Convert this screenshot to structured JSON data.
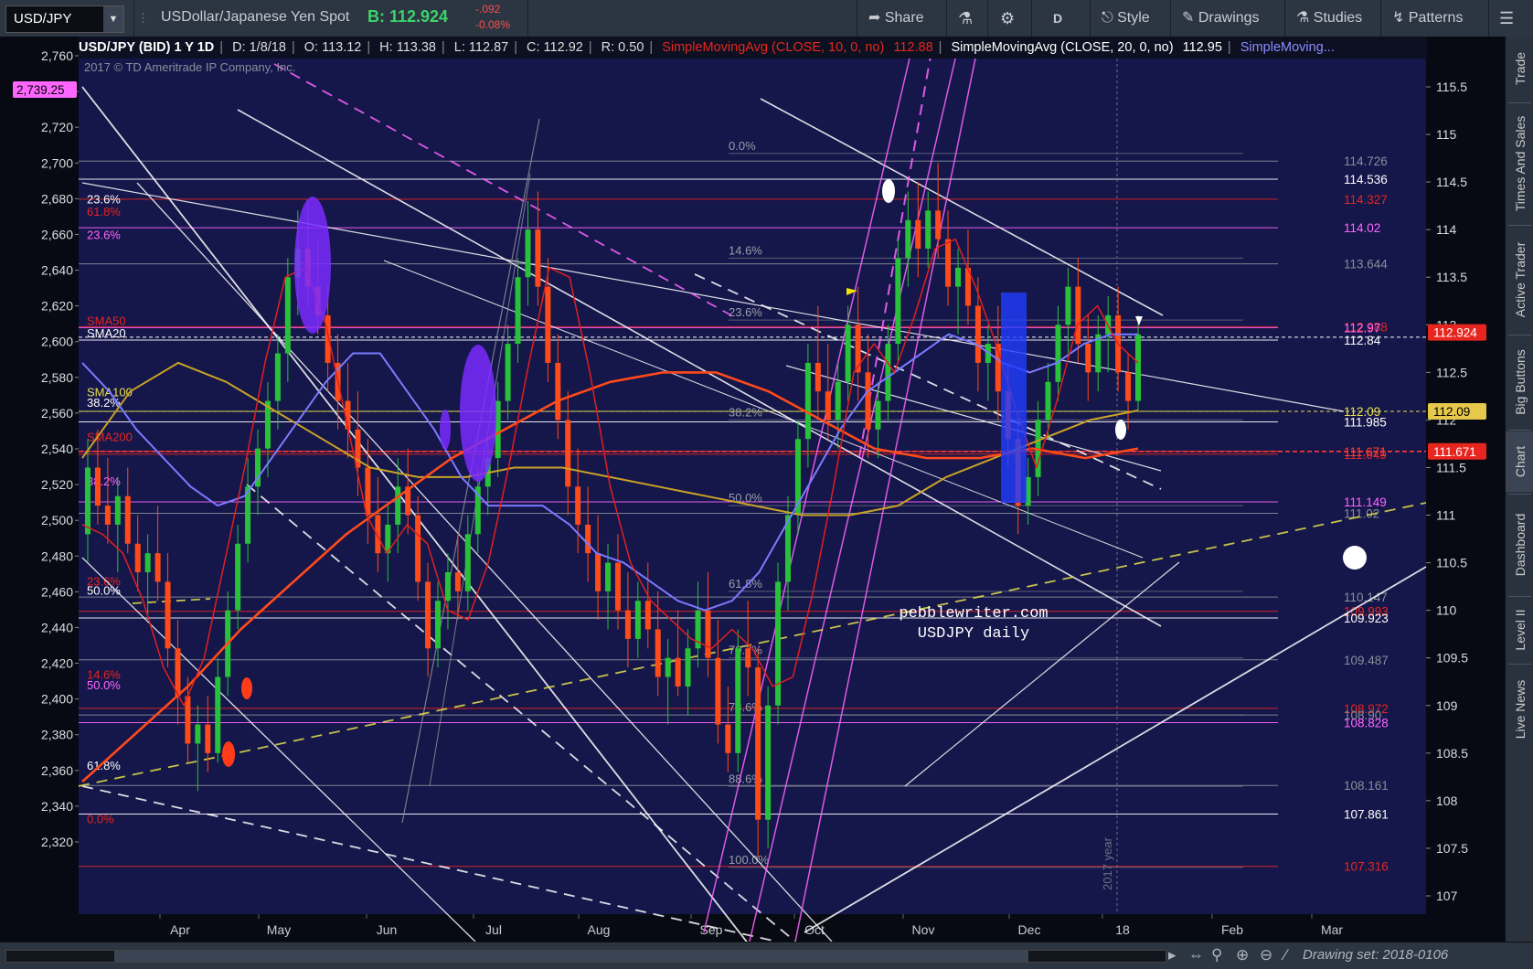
{
  "toolbar": {
    "symbol": "USD/JPY",
    "description": "USDollar/Japanese Yen Spot",
    "bid": "B: 112.924",
    "change": "-.092",
    "change_pct": "-0.08%",
    "share": "Share",
    "aggregation": "D",
    "style": "Style",
    "drawings": "Drawings",
    "studies": "Studies",
    "patterns": "Patterns"
  },
  "infobar": {
    "title": "USD/JPY (BID) 1 Y 1D",
    "date": "D: 1/8/18",
    "open": "O: 113.12",
    "high": "H: 113.38",
    "low": "L: 112.87",
    "close": "C: 112.92",
    "range": "R: 0.50",
    "sma10": "SimpleMovingAvg (CLOSE, 10, 0, no)",
    "sma10_val": "112.88",
    "sma20": "SimpleMovingAvg (CLOSE, 20, 0, no)",
    "sma20_val": "112.95",
    "sma_more": "SimpleMoving..."
  },
  "sidebar": [
    "Trade",
    "Times And Sales",
    "Active Trader",
    "Big Buttons",
    "Chart",
    "Dashboard",
    "Level II",
    "Live News"
  ],
  "bottom": {
    "drawing_set": "Drawing set: 2018-0106"
  },
  "chart_data": {
    "type": "candlestick",
    "copyright": "2017 © TD Ameritrade IP Company, Inc.",
    "watermark": [
      "pebblewriter.com",
      "USDJPY daily"
    ],
    "year_marker": "2017 year",
    "x_labels": [
      "Apr",
      "May",
      "Jun",
      "Jul",
      "Aug",
      "Sep",
      "Oct",
      "Nov",
      "Dec",
      "18",
      "Feb",
      "Mar"
    ],
    "y_right": {
      "min": 107,
      "max": 115.5,
      "ticks": [
        "115.5",
        "115",
        "114.5",
        "114",
        "113.5",
        "113",
        "112.5",
        "112",
        "111.5",
        "111",
        "110.5",
        "110",
        "109.5",
        "109",
        "108.5",
        "108",
        "107.5",
        "107"
      ]
    },
    "y_left": {
      "min": 2320,
      "max": 2760,
      "ticks": [
        "2,760",
        "2,740",
        "2,720",
        "2,700",
        "2,680",
        "2,660",
        "2,640",
        "2,620",
        "2,600",
        "2,580",
        "2,560",
        "2,540",
        "2,520",
        "2,500",
        "2,480",
        "2,460",
        "2,440",
        "2,420",
        "2,400",
        "2,380",
        "2,360",
        "2,340",
        "2,320"
      ]
    },
    "left_tag": "2,739.25",
    "price_tags": [
      {
        "value": 112.92,
        "text": "112.924",
        "bg": "#e8261f",
        "fg": "#ffffff"
      },
      {
        "value": 112.09,
        "text": "112.09",
        "bg": "#e6c84a",
        "fg": "#000000"
      },
      {
        "value": 111.67,
        "text": "111.671",
        "bg": "#e8261f",
        "fg": "#ffffff"
      }
    ],
    "hlines": [
      {
        "value": 114.72,
        "color": "#8a8f98",
        "text": "114.726",
        "lcolor": "#8a8f98"
      },
      {
        "value": 114.53,
        "color": "#ffffff",
        "text": "114.536",
        "lcolor": "#ffffff"
      },
      {
        "value": 114.32,
        "color": "#e8261f",
        "text": "114.327",
        "lcolor": "#e8261f"
      },
      {
        "value": 114.02,
        "color": "#ff66ff",
        "text": "114.02",
        "lcolor": "#ff66ff"
      },
      {
        "value": 113.64,
        "color": "#8a8f98",
        "text": "113.644",
        "lcolor": "#8a8f98"
      },
      {
        "value": 112.98,
        "color": "#e8261f",
        "text": "112.988",
        "lcolor": "#e8261f"
      },
      {
        "value": 112.97,
        "color": "#ff66ff",
        "text": "112.97",
        "lcolor": "#ff66ff"
      },
      {
        "value": 112.84,
        "color": "#ffffff",
        "text": "112.84",
        "lcolor": "#ffffff"
      },
      {
        "value": 112.09,
        "color": "#e6e14a",
        "text": "112.09",
        "lcolor": "#e6e14a"
      },
      {
        "value": 111.98,
        "color": "#ffffff",
        "text": "111.985",
        "lcolor": "#ffffff"
      },
      {
        "value": 111.64,
        "color": "#e8261f",
        "text": "111.649",
        "lcolor": "#e8261f"
      },
      {
        "value": 111.67,
        "color": "#ff3b30",
        "text": "111.671",
        "lcolor": "#ff3b30"
      },
      {
        "value": 111.14,
        "color": "#ff66ff",
        "text": "111.149",
        "lcolor": "#ff66ff"
      },
      {
        "value": 111.02,
        "color": "#8a8f98",
        "text": "111.02",
        "lcolor": "#8a8f98"
      },
      {
        "value": 110.14,
        "color": "#8a8f98",
        "text": "110.147",
        "lcolor": "#8a8f98"
      },
      {
        "value": 109.99,
        "color": "#e8261f",
        "text": "109.993",
        "lcolor": "#e8261f"
      },
      {
        "value": 109.92,
        "color": "#ffffff",
        "text": "109.923",
        "lcolor": "#ffffff"
      },
      {
        "value": 109.48,
        "color": "#8a8f98",
        "text": "109.487",
        "lcolor": "#8a8f98"
      },
      {
        "value": 108.97,
        "color": "#e8261f",
        "text": "108.972",
        "lcolor": "#e8261f"
      },
      {
        "value": 108.9,
        "color": "#8a8f98",
        "text": "108.90",
        "lcolor": "#8a8f98"
      },
      {
        "value": 108.82,
        "color": "#ff66ff",
        "text": "108.828",
        "lcolor": "#ff66ff"
      },
      {
        "value": 108.16,
        "color": "#8a8f98",
        "text": "108.161",
        "lcolor": "#8a8f98"
      },
      {
        "value": 107.86,
        "color": "#ffffff",
        "text": "107.861",
        "lcolor": "#ffffff"
      },
      {
        "value": 107.31,
        "color": "#e8261f",
        "text": "107.316",
        "lcolor": "#e8261f"
      }
    ],
    "fib_left": [
      {
        "text": "23.6%",
        "value": 2680,
        "color": "#ffffff"
      },
      {
        "text": "61.8%",
        "value": 2673,
        "color": "#e8261f"
      },
      {
        "text": "23.6%",
        "value": 2660,
        "color": "#ff66ff"
      },
      {
        "text": "SMA50",
        "value": 2612,
        "color": "#e8261f"
      },
      {
        "text": "SMA20",
        "value": 2605,
        "color": "#ffffff"
      },
      {
        "text": "SMA100",
        "value": 2572,
        "color": "#e6e14a"
      },
      {
        "text": "38.2%",
        "value": 2566,
        "color": "#ffffff"
      },
      {
        "text": "SMA200",
        "value": 2547,
        "color": "#e8261f"
      },
      {
        "text": "38.2%",
        "value": 2522,
        "color": "#ff66ff"
      },
      {
        "text": "23.6%",
        "value": 2466,
        "color": "#e8261f"
      },
      {
        "text": "50.0%",
        "value": 2461,
        "color": "#ffffff"
      },
      {
        "text": "14.6%",
        "value": 2414,
        "color": "#e8261f"
      },
      {
        "text": "50.0%",
        "value": 2408,
        "color": "#ff66ff"
      },
      {
        "text": "61.8%",
        "value": 2363,
        "color": "#ffffff"
      },
      {
        "text": "0.0%",
        "value": 2333,
        "color": "#e8261f"
      }
    ],
    "fib_mid": [
      {
        "text": "0.0%",
        "value": 114.8
      },
      {
        "text": "14.6%",
        "value": 113.7
      },
      {
        "text": "23.6%",
        "value": 113.05
      },
      {
        "text": "38.2%",
        "value": 112.0
      },
      {
        "text": "50.0%",
        "value": 111.1
      },
      {
        "text": "61.8%",
        "value": 110.2
      },
      {
        "text": "70.7%",
        "value": 109.5
      },
      {
        "text": "78.6%",
        "value": 108.9
      },
      {
        "text": "88.6%",
        "value": 108.15
      },
      {
        "text": "100.0%",
        "value": 107.3
      }
    ],
    "candles": [
      [
        110.8,
        111.8,
        110.5,
        111.5
      ],
      [
        111.5,
        111.9,
        110.9,
        111.1
      ],
      [
        111.1,
        111.6,
        110.7,
        110.9
      ],
      [
        110.9,
        111.4,
        110.4,
        111.2
      ],
      [
        111.2,
        111.5,
        110.6,
        110.7
      ],
      [
        110.7,
        111.0,
        110.2,
        110.4
      ],
      [
        110.4,
        110.8,
        109.9,
        110.6
      ],
      [
        110.6,
        111.1,
        110.1,
        110.3
      ],
      [
        110.3,
        110.6,
        109.4,
        109.6
      ],
      [
        109.6,
        109.9,
        108.8,
        109.1
      ],
      [
        109.1,
        109.3,
        108.4,
        108.6
      ],
      [
        108.6,
        109.0,
        108.1,
        108.8
      ],
      [
        108.8,
        109.1,
        108.3,
        108.5
      ],
      [
        108.5,
        109.5,
        108.4,
        109.3
      ],
      [
        109.3,
        110.2,
        109.1,
        110.0
      ],
      [
        110.0,
        110.9,
        109.8,
        110.7
      ],
      [
        110.7,
        111.6,
        110.5,
        111.3
      ],
      [
        111.3,
        111.9,
        111.0,
        111.7
      ],
      [
        111.7,
        112.4,
        111.4,
        112.2
      ],
      [
        112.2,
        112.9,
        111.9,
        112.7
      ],
      [
        112.7,
        113.7,
        112.4,
        113.5
      ],
      [
        113.5,
        114.2,
        113.1,
        113.8
      ],
      [
        113.8,
        114.3,
        113.2,
        113.4
      ],
      [
        113.4,
        113.9,
        112.9,
        113.1
      ],
      [
        113.1,
        113.4,
        112.3,
        112.6
      ],
      [
        112.6,
        112.9,
        111.9,
        112.2
      ],
      [
        112.2,
        112.6,
        111.6,
        111.9
      ],
      [
        111.9,
        112.3,
        111.2,
        111.5
      ],
      [
        111.5,
        111.8,
        110.7,
        111.0
      ],
      [
        111.0,
        111.4,
        110.4,
        110.6
      ],
      [
        110.6,
        111.1,
        110.3,
        110.9
      ],
      [
        110.9,
        111.6,
        110.6,
        111.3
      ],
      [
        111.3,
        111.7,
        110.8,
        111.0
      ],
      [
        111.0,
        111.2,
        110.1,
        110.3
      ],
      [
        110.3,
        110.5,
        109.3,
        109.6
      ],
      [
        109.6,
        110.3,
        109.4,
        110.1
      ],
      [
        110.1,
        110.6,
        109.8,
        110.4
      ],
      [
        110.4,
        110.8,
        109.9,
        110.2
      ],
      [
        110.2,
        111.0,
        110.0,
        110.8
      ],
      [
        110.8,
        111.5,
        110.6,
        111.3
      ],
      [
        111.3,
        111.8,
        111.0,
        111.6
      ],
      [
        111.6,
        112.4,
        111.4,
        112.2
      ],
      [
        112.2,
        113.0,
        112.0,
        112.8
      ],
      [
        112.8,
        113.7,
        112.6,
        113.5
      ],
      [
        113.5,
        114.3,
        113.2,
        114.0
      ],
      [
        114.0,
        114.4,
        113.2,
        113.4
      ],
      [
        113.4,
        113.7,
        112.4,
        112.6
      ],
      [
        112.6,
        112.9,
        111.8,
        112.0
      ],
      [
        112.0,
        112.3,
        111.0,
        111.3
      ],
      [
        111.3,
        111.7,
        110.6,
        110.9
      ],
      [
        110.9,
        111.3,
        110.3,
        110.6
      ],
      [
        110.6,
        111.0,
        109.9,
        110.2
      ],
      [
        110.2,
        110.7,
        109.8,
        110.5
      ],
      [
        110.5,
        110.8,
        109.8,
        110.0
      ],
      [
        110.0,
        110.4,
        109.4,
        109.7
      ],
      [
        109.7,
        110.3,
        109.5,
        110.1
      ],
      [
        110.1,
        110.5,
        109.6,
        109.8
      ],
      [
        109.8,
        110.2,
        109.1,
        109.3
      ],
      [
        109.3,
        109.7,
        108.8,
        109.5
      ],
      [
        109.5,
        110.0,
        109.1,
        109.2
      ],
      [
        109.2,
        109.8,
        108.9,
        109.6
      ],
      [
        109.6,
        110.3,
        109.4,
        110.0
      ],
      [
        110.0,
        110.4,
        109.3,
        109.5
      ],
      [
        109.5,
        109.9,
        108.6,
        108.8
      ],
      [
        108.8,
        109.2,
        108.3,
        108.5
      ],
      [
        108.5,
        109.8,
        108.3,
        109.6
      ],
      [
        109.6,
        110.1,
        109.1,
        109.4
      ],
      [
        109.4,
        109.6,
        107.4,
        107.8
      ],
      [
        107.8,
        109.2,
        107.5,
        109.0
      ],
      [
        109.0,
        110.5,
        108.8,
        110.3
      ],
      [
        110.3,
        111.2,
        110.0,
        111.0
      ],
      [
        111.0,
        112.0,
        110.8,
        111.8
      ],
      [
        111.8,
        112.8,
        111.5,
        112.6
      ],
      [
        112.6,
        113.2,
        112.0,
        112.3
      ],
      [
        112.3,
        112.8,
        111.8,
        112.0
      ],
      [
        112.0,
        112.6,
        111.7,
        112.4
      ],
      [
        112.4,
        113.2,
        112.2,
        113.0
      ],
      [
        113.0,
        113.4,
        112.2,
        112.5
      ],
      [
        112.5,
        112.9,
        111.6,
        111.9
      ],
      [
        111.9,
        112.4,
        111.6,
        112.2
      ],
      [
        112.2,
        113.0,
        112.0,
        112.8
      ],
      [
        112.8,
        113.9,
        112.6,
        113.7
      ],
      [
        113.7,
        114.4,
        113.4,
        114.1
      ],
      [
        114.1,
        114.5,
        113.5,
        113.8
      ],
      [
        113.8,
        114.4,
        113.6,
        114.2
      ],
      [
        114.2,
        114.7,
        113.7,
        113.9
      ],
      [
        113.9,
        114.2,
        113.2,
        113.4
      ],
      [
        113.4,
        113.8,
        112.9,
        113.6
      ],
      [
        113.6,
        114.0,
        113.0,
        113.2
      ],
      [
        113.2,
        113.5,
        112.3,
        112.6
      ],
      [
        112.6,
        113.0,
        112.2,
        112.8
      ],
      [
        112.8,
        113.2,
        112.0,
        112.3
      ],
      [
        112.3,
        112.6,
        111.5,
        111.8
      ],
      [
        111.8,
        112.1,
        110.8,
        111.1
      ],
      [
        111.1,
        111.6,
        110.9,
        111.4
      ],
      [
        111.4,
        112.2,
        111.2,
        112.0
      ],
      [
        112.0,
        112.6,
        111.8,
        112.4
      ],
      [
        112.4,
        113.2,
        112.2,
        113.0
      ],
      [
        113.0,
        113.6,
        112.7,
        113.4
      ],
      [
        113.4,
        113.7,
        112.6,
        112.8
      ],
      [
        112.8,
        113.1,
        112.2,
        112.5
      ],
      [
        112.5,
        113.1,
        112.3,
        112.9
      ],
      [
        112.9,
        113.3,
        112.5,
        113.1
      ],
      [
        113.1,
        113.4,
        112.3,
        112.5
      ],
      [
        112.5,
        112.7,
        111.9,
        112.2
      ],
      [
        112.2,
        113.1,
        112.1,
        112.9
      ]
    ],
    "sma_red": [
      110.9,
      110.8,
      110.6,
      110.1,
      109.4,
      109.0,
      109.5,
      110.5,
      111.5,
      112.6,
      113.5,
      113.6,
      113.0,
      112.0,
      111.0,
      110.6,
      110.9,
      110.7,
      110.0,
      109.9,
      110.5,
      111.5,
      112.6,
      113.6,
      113.5,
      112.5,
      111.3,
      110.5,
      110.1,
      109.9,
      109.7,
      109.6,
      109.8,
      109.6,
      109.2,
      109.3,
      110.2,
      111.3,
      112.5,
      112.8,
      112.5,
      113.1,
      113.8,
      113.9,
      113.4,
      112.8,
      112.1,
      111.5,
      112.2,
      113.0,
      113.2,
      112.8,
      112.6
    ],
    "sma_blue": [
      112.6,
      112.3,
      111.9,
      111.6,
      111.3,
      111.1,
      111.2,
      111.6,
      112.0,
      112.4,
      112.7,
      112.7,
      112.3,
      111.9,
      111.4,
      111.1,
      111.1,
      111.1,
      110.9,
      110.6,
      110.5,
      110.3,
      110.1,
      110.0,
      110.1,
      110.4,
      110.9,
      111.4,
      111.9,
      112.3,
      112.5,
      112.7,
      112.9,
      112.8,
      112.6,
      112.5,
      112.6,
      112.8,
      112.9,
      112.9
    ],
    "sma_gold": [
      111.6,
      112.3,
      112.6,
      112.4,
      112.1,
      111.8,
      111.5,
      111.4,
      111.4,
      111.5,
      111.5,
      111.4,
      111.3,
      111.2,
      111.1,
      111.0,
      111.0,
      111.1,
      111.4,
      111.6,
      111.8,
      112.0,
      112.1
    ],
    "sma_orange": [
      108.2,
      108.7,
      109.2,
      109.8,
      110.3,
      110.8,
      111.2,
      111.6,
      111.9,
      112.2,
      112.4,
      112.5,
      112.5,
      112.3,
      112.0,
      111.7,
      111.6,
      111.6,
      111.7,
      111.6,
      111.7
    ]
  }
}
